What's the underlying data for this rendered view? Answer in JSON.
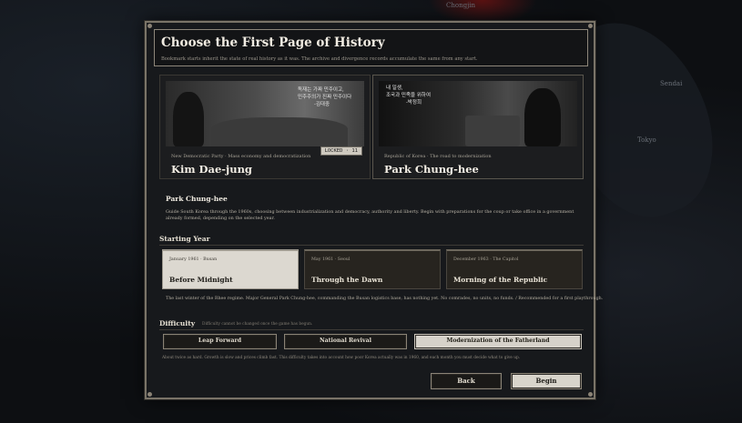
{
  "background": {
    "map_labels": [
      "Chongjin",
      "Sendai",
      "Tokyo"
    ]
  },
  "dialog": {
    "title": "Choose the First Page of History",
    "subtitle": "Bookmark starts inherit the state of real history as it was. The archive and divergence records accumulate the same from any start."
  },
  "leaders": [
    {
      "tag": "New Democratic Party · Mass economy and democratization",
      "name": "Kim Dae-jung",
      "quote": [
        "독재는 가짜 민주이고,",
        "민주주의가 진짜 민주이다",
        "-김대중"
      ],
      "locked_label": "LOCKED · 11",
      "selected": false
    },
    {
      "tag": "Republic of Korea · The road to modernization",
      "name": "Park Chung-hee",
      "quote": [
        "내 일생,",
        "조국과 민족을 위하여",
        "-박정희"
      ],
      "selected": true
    }
  ],
  "selected_leader": {
    "name": "Park Chung-hee",
    "description": "Guide South Korea through the 1960s, choosing between industrialization and democracy, authority and liberty. Begin with preparations for the coup or take office in a government already formed, depending on the selected year."
  },
  "starting_year": {
    "label": "Starting Year",
    "options": [
      {
        "date": "January 1961 · Busan",
        "title": "Before Midnight",
        "active": true
      },
      {
        "date": "May 1961 · Seoul",
        "title": "Through the Dawn",
        "active": false
      },
      {
        "date": "December 1963 · The Capitol",
        "title": "Morning of the Republic",
        "active": false
      }
    ],
    "description": "The last winter of the Rhee regime. Major General Park Chung-hee, commanding the Busan logistics base, has nothing yet. No comrades, no units, no funds. / Recommended for a first playthrough."
  },
  "difficulty": {
    "label": "Difficulty",
    "note": "Difficulty cannot be changed once the game has begun.",
    "options": [
      {
        "label": "Leap Forward",
        "active": false
      },
      {
        "label": "National Revival",
        "active": false
      },
      {
        "label": "Modernization of the Fatherland",
        "active": true
      }
    ],
    "description": "About twice as hard. Growth is slow and prices climb fast. This difficulty takes into account how poor Korea actually was in 1960, and each month you must decide what to give up."
  },
  "buttons": {
    "back": "Back",
    "begin": "Begin"
  }
}
